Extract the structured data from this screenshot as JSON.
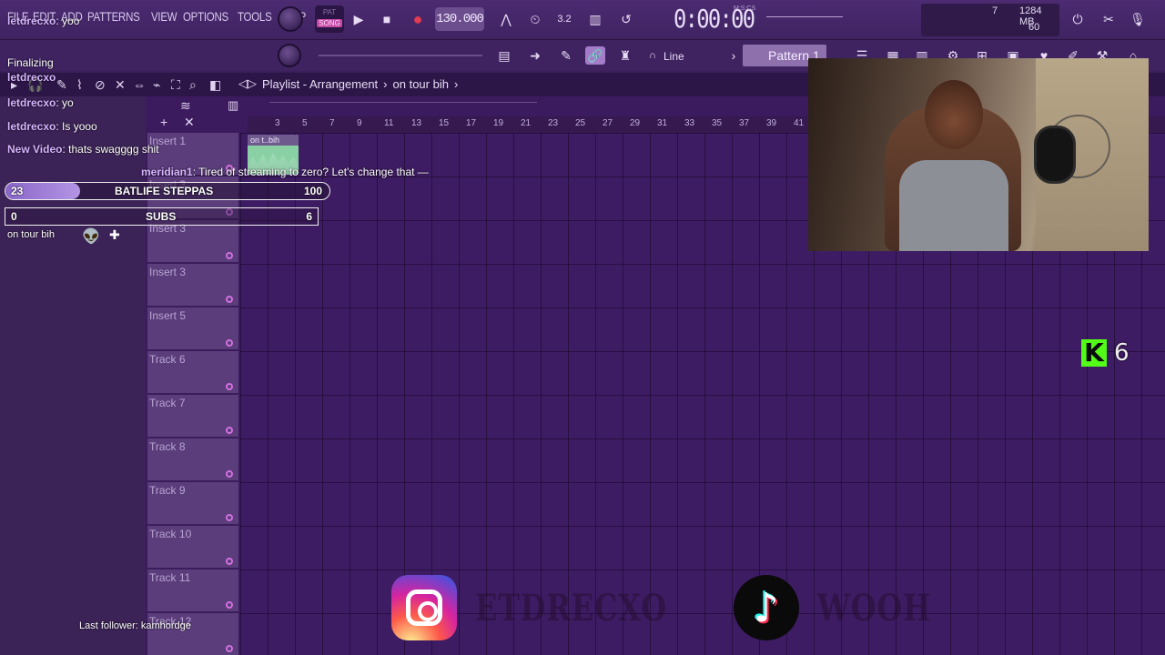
{
  "menu": [
    "FILE",
    "EDIT",
    "ADD",
    "PATTERNS",
    "VIEW",
    "OPTIONS",
    "TOOLS",
    "HELP"
  ],
  "transport": {
    "pat_label": "PAT",
    "song_label": "SONG",
    "tempo": "130.000",
    "time": "0:00:00",
    "time_mode": "M:S:CS"
  },
  "cpu": {
    "voices": "7",
    "memory": "1284 MB",
    "cpu": "60"
  },
  "toolbar2": {
    "snap": "Line",
    "pattern": "Pattern 1"
  },
  "playlist": {
    "title": "Playlist - Arrangement",
    "arrangement": "on tour bih",
    "clip_label": "on t..bih",
    "ruler": [
      "3",
      "5",
      "7",
      "9",
      "11",
      "13",
      "15",
      "17",
      "19",
      "21",
      "23",
      "25",
      "27",
      "29",
      "31",
      "33",
      "35",
      "37",
      "39",
      "41"
    ],
    "tracks": [
      "Insert 1",
      "Insert 3",
      "Insert 3",
      "Insert 3",
      "Insert 5",
      "Track 6",
      "Track 7",
      "Track 8",
      "Track 9",
      "Track 10",
      "Track 11",
      "Track 12"
    ]
  },
  "overlay": {
    "chat": [
      {
        "user": "letdrecxo",
        "msg": "yoo"
      },
      {
        "user": "",
        "msg": "Finalizing"
      },
      {
        "user": "letdrecxo",
        "msg": ""
      },
      {
        "user": "letdrecxo",
        "msg": "yo"
      },
      {
        "user": "letdrecxo",
        "msg": "Is yooo"
      },
      {
        "user": "New Video",
        "msg": "thats swagggg shit"
      },
      {
        "user": "meridian1",
        "msg": "Tired of streaming to zero? Let's change that —"
      }
    ],
    "goal1": {
      "current": "23",
      "label": "BATLIFE STEPPAS",
      "target": "100",
      "progress": 0.23
    },
    "goal2": {
      "current": "0",
      "label": "SUBS",
      "target": "6"
    },
    "now_playing": "on tour bih",
    "kick_viewers": "6",
    "last_follower": "Last follower: kamhordge",
    "instagram_handle": "ETDRECXO",
    "tiktok_handle": "WOOH"
  },
  "colors": {
    "accent": "#c64aa8",
    "kick": "#53fc18",
    "track_dot": "#d36fe0"
  }
}
